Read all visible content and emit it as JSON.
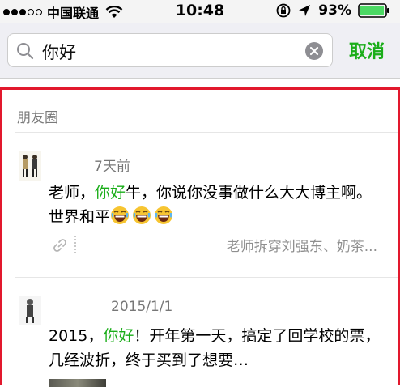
{
  "status_bar": {
    "carrier": "中国联通",
    "time": "10:48",
    "battery": "93%",
    "signal_icon": "signal-dots-icon",
    "wifi_icon": "wifi-icon",
    "battery_color": "#4cd964"
  },
  "search": {
    "value": "你好",
    "cancel_label": "取消"
  },
  "results": {
    "section_title": "朋友圈",
    "highlight_color": "#e2182d",
    "keyword_color": "#1aad19",
    "posts": [
      {
        "time": "7天前",
        "text_before": "老师，",
        "keyword": "你好",
        "text_after": "牛，你说你没事做什么大大博主啊。世界和平",
        "emoji_icon": "laughing-tears-emoji",
        "link_text": "老师拆穿刘强东、奶茶..."
      },
      {
        "time": "2015/1/1",
        "text_before": "2015，",
        "keyword": "你好",
        "text_after": "！开年第一天，搞定了回学校的票，几经波折，终于买到了想要…"
      }
    ]
  }
}
